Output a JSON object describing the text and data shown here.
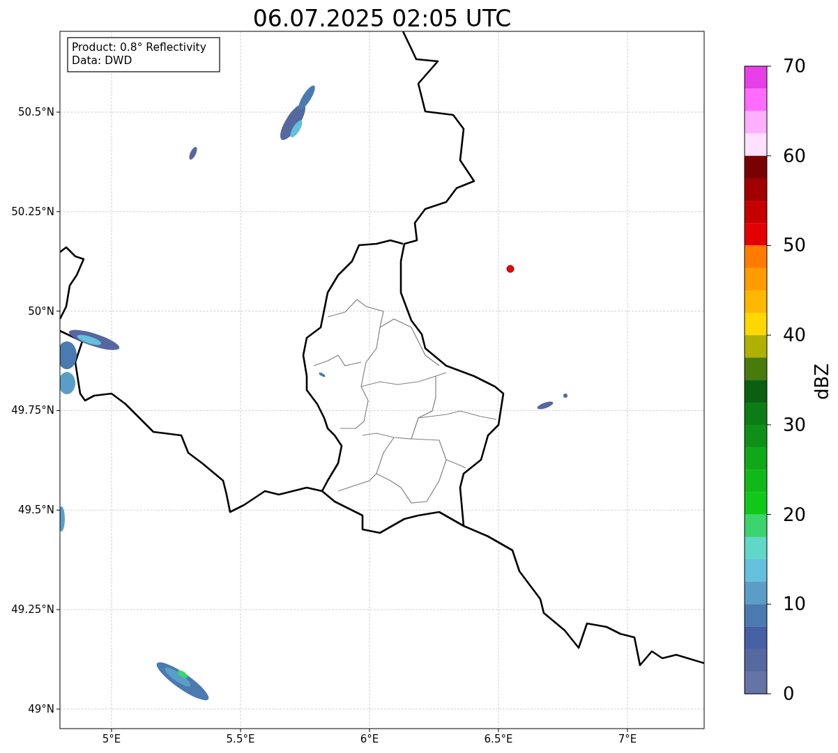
{
  "title": "06.07.2025 02:05 UTC",
  "info_box": {
    "lines": [
      "Product: 0.8° Reflectivity",
      "Data: DWD"
    ]
  },
  "map": {
    "lon_ticks": [
      "5°E",
      "5.5°E",
      "6°E",
      "6.5°E",
      "7°E"
    ],
    "lat_ticks": [
      "50.5°N",
      "50.25°N",
      "50°N",
      "49.75°N",
      "49.5°N",
      "49.25°N",
      "49°N"
    ]
  },
  "colorbar": {
    "label": "dBZ",
    "ticks": [
      "70",
      "60",
      "50",
      "40",
      "30",
      "20",
      "10",
      "0"
    ],
    "bins": [
      {
        "color": "#e840e8"
      },
      {
        "color": "#ff6cff"
      },
      {
        "color": "#ffb0ff"
      },
      {
        "color": "#ffe0ff"
      },
      {
        "color": "#780000"
      },
      {
        "color": "#a00000"
      },
      {
        "color": "#c40000"
      },
      {
        "color": "#e40000"
      },
      {
        "color": "#ff7c00"
      },
      {
        "color": "#ff9c00"
      },
      {
        "color": "#ffb800"
      },
      {
        "color": "#ffd800"
      },
      {
        "color": "#b0b000"
      },
      {
        "color": "#487a0c"
      },
      {
        "color": "#0a6010"
      },
      {
        "color": "#0c7c14"
      },
      {
        "color": "#0e9018"
      },
      {
        "color": "#10a818"
      },
      {
        "color": "#10b818"
      },
      {
        "color": "#10c818"
      },
      {
        "color": "#3cd46c"
      },
      {
        "color": "#60d8c8"
      },
      {
        "color": "#64c0dc"
      },
      {
        "color": "#5a9ec8"
      },
      {
        "color": "#4a7ab0"
      },
      {
        "color": "#4560a4"
      },
      {
        "color": "#5568a0"
      },
      {
        "color": "#6673a6"
      }
    ]
  }
}
